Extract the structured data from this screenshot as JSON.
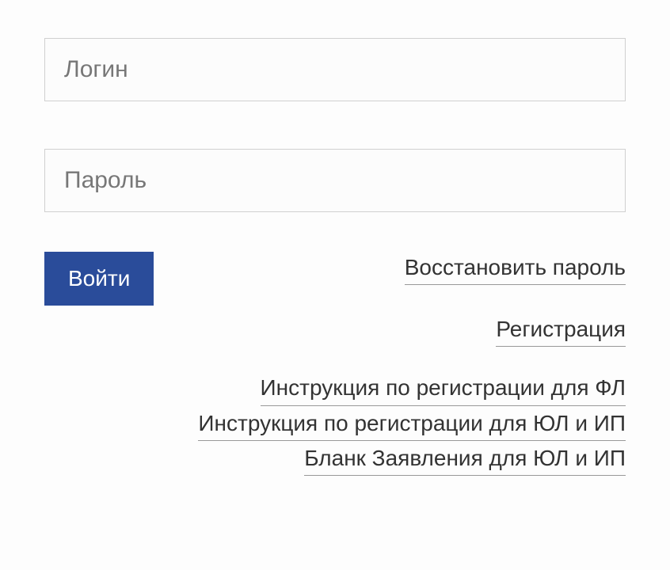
{
  "login": {
    "username_placeholder": "Логин",
    "username_value": "",
    "password_placeholder": "Пароль",
    "password_value": "",
    "submit_label": "Войти"
  },
  "links": {
    "recover_password": "Восстановить пароль",
    "register": "Регистрация",
    "instruction_fl": "Инструкция по регистрации для ФЛ",
    "instruction_ul_ip": "Инструкция по регистрации для ЮЛ и ИП",
    "application_form": "Бланк Заявления для ЮЛ и ИП"
  }
}
